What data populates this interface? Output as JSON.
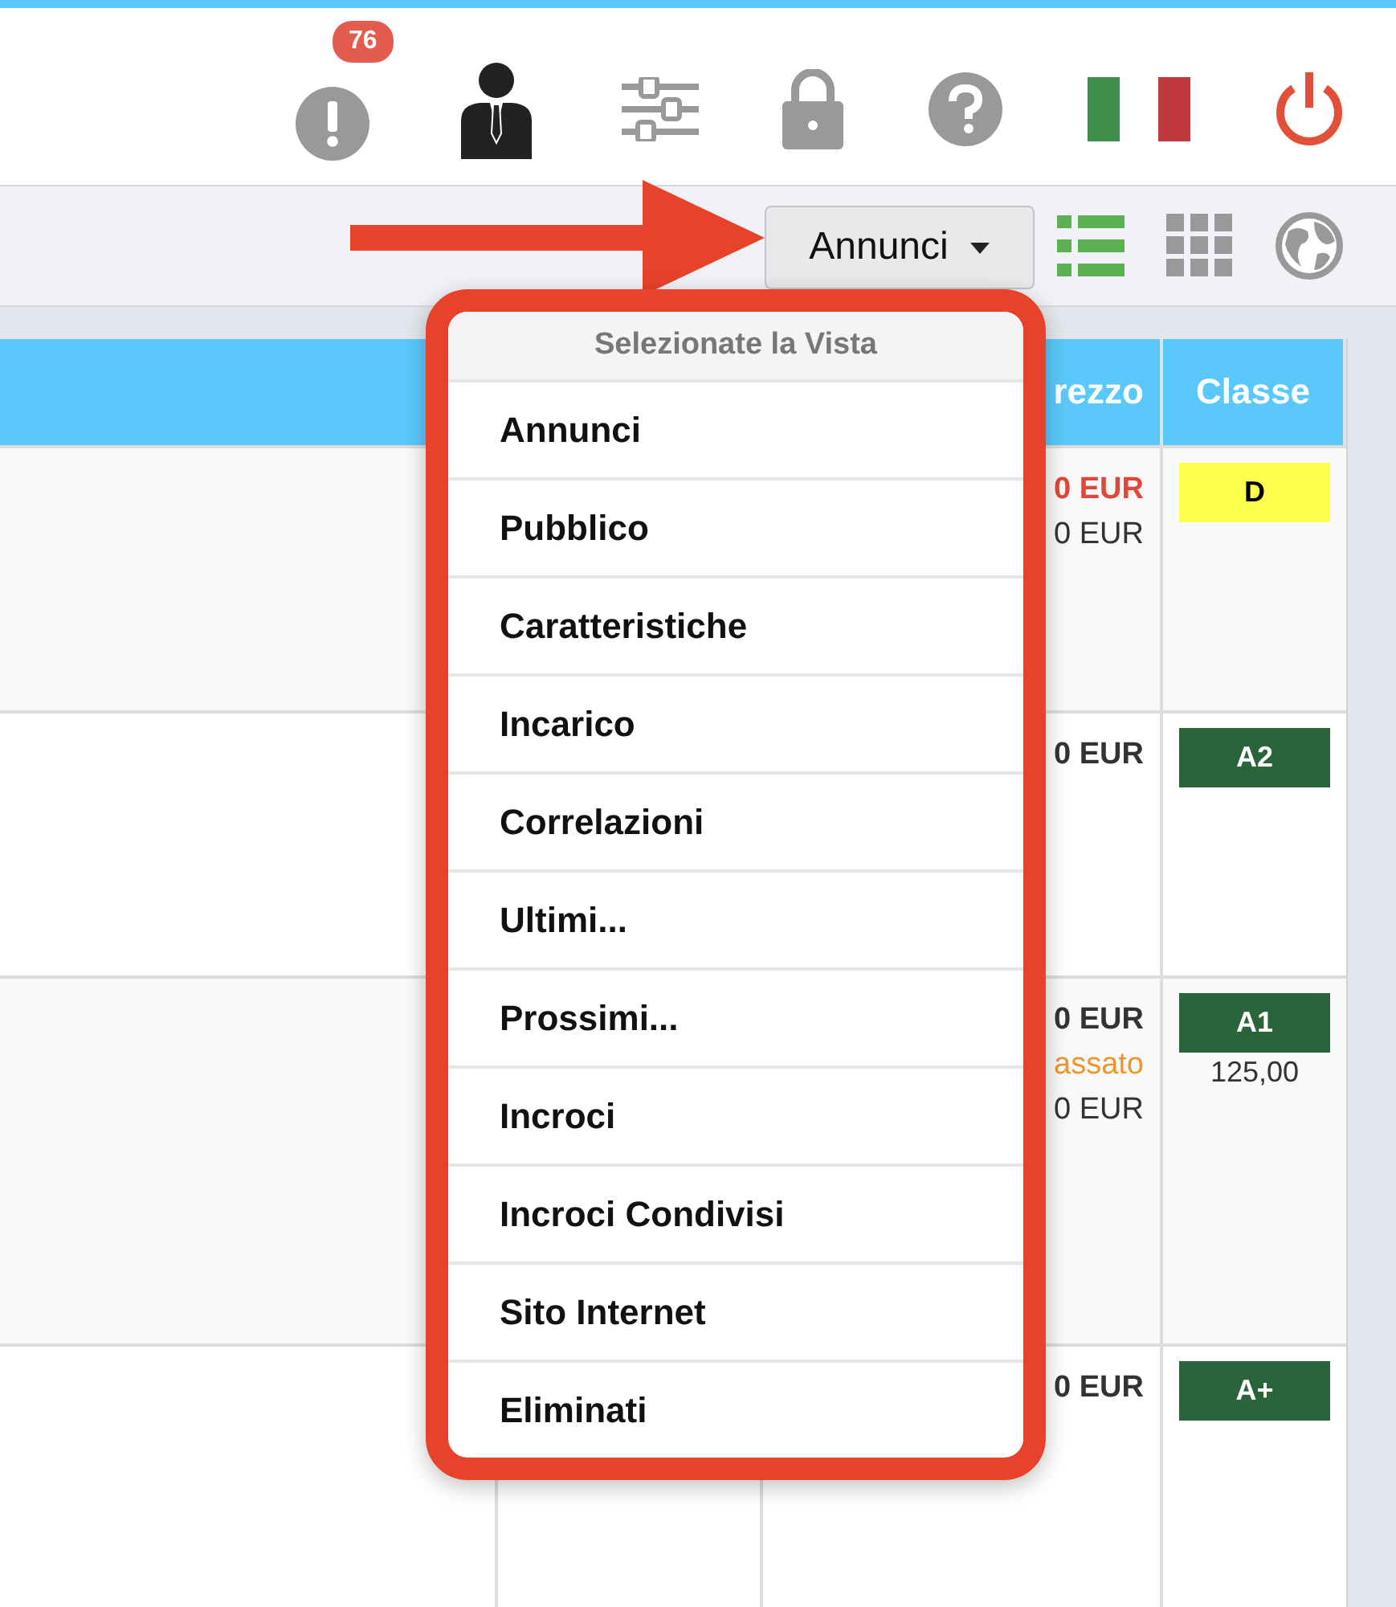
{
  "header": {
    "notification_count": "76"
  },
  "toolbar": {
    "view_button": "Annunci"
  },
  "table": {
    "headers": {
      "price": "rezzo",
      "class": "Classe"
    },
    "rows": [
      {
        "price_lines": [
          {
            "text": "0 EUR",
            "kind": "alert"
          },
          {
            "text": "0 EUR",
            "kind": "plain"
          }
        ],
        "class": {
          "label": "D",
          "color": "#ffff4d"
        }
      },
      {
        "price_lines": [
          {
            "text": "0 EUR",
            "kind": "strong"
          }
        ],
        "class": {
          "label": "A2",
          "color": "#2a643a"
        }
      },
      {
        "price_lines": [
          {
            "text": "0 EUR",
            "kind": "strong"
          },
          {
            "text": "assato",
            "kind": "warning"
          },
          {
            "text": "0 EUR",
            "kind": "plain"
          }
        ],
        "class": {
          "label": "A1",
          "color": "#2a643a"
        },
        "class_note": "125,00"
      },
      {
        "price_lines": [
          {
            "text": "0 EUR",
            "kind": "strong"
          }
        ],
        "class": {
          "label": "A+",
          "color": "#2a643a"
        }
      }
    ]
  },
  "menu": {
    "title": "Selezionate la Vista",
    "items": [
      "Annunci",
      "Pubblico",
      "Caratteristiche",
      "Incarico",
      "Correlazioni",
      "Ultimi...",
      "Prossimi...",
      "Incroci",
      "Incroci Condivisi",
      "Sito Internet",
      "Eliminati"
    ]
  }
}
